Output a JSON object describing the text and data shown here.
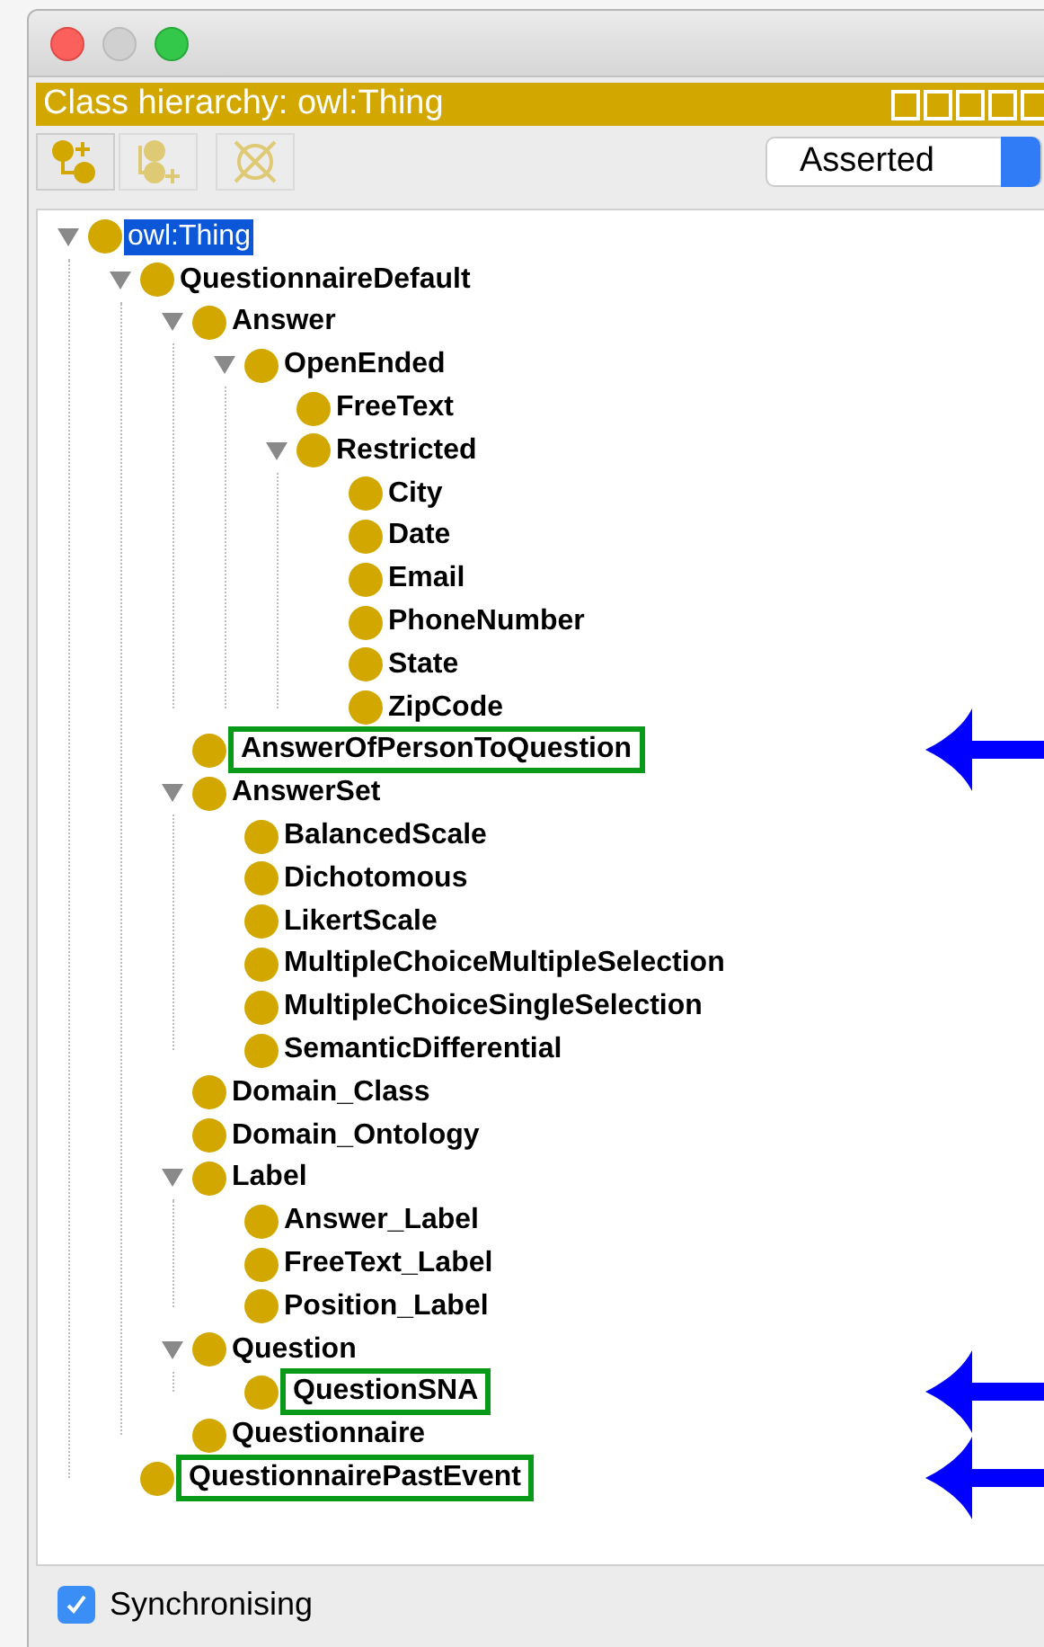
{
  "window": {
    "title": "Class hierarchy: owl:Thing"
  },
  "toolbar": {
    "view_select": {
      "value": "Asserted"
    }
  },
  "tree": [
    {
      "label": "owl:Thing",
      "selected": true,
      "boxed": false,
      "expanded": true,
      "children": [
        {
          "label": "QuestionnaireDefault",
          "selected": false,
          "boxed": false,
          "expanded": true,
          "children": [
            {
              "label": "Answer",
              "selected": false,
              "boxed": false,
              "expanded": true,
              "children": [
                {
                  "label": "OpenEnded",
                  "selected": false,
                  "boxed": false,
                  "expanded": true,
                  "children": [
                    {
                      "label": "FreeText",
                      "selected": false,
                      "boxed": false
                    },
                    {
                      "label": "Restricted",
                      "selected": false,
                      "boxed": false,
                      "expanded": true,
                      "children": [
                        {
                          "label": "City",
                          "selected": false,
                          "boxed": false
                        },
                        {
                          "label": "Date",
                          "selected": false,
                          "boxed": false
                        },
                        {
                          "label": "Email",
                          "selected": false,
                          "boxed": false
                        },
                        {
                          "label": "PhoneNumber",
                          "selected": false,
                          "boxed": false
                        },
                        {
                          "label": "State",
                          "selected": false,
                          "boxed": false
                        },
                        {
                          "label": "ZipCode",
                          "selected": false,
                          "boxed": false
                        }
                      ]
                    }
                  ]
                }
              ]
            },
            {
              "label": "AnswerOfPersonToQuestion",
              "selected": false,
              "boxed": true
            },
            {
              "label": "AnswerSet",
              "selected": false,
              "boxed": false,
              "expanded": true,
              "children": [
                {
                  "label": "BalancedScale",
                  "selected": false,
                  "boxed": false
                },
                {
                  "label": "Dichotomous",
                  "selected": false,
                  "boxed": false
                },
                {
                  "label": "LikertScale",
                  "selected": false,
                  "boxed": false
                },
                {
                  "label": "MultipleChoiceMultipleSelection",
                  "selected": false,
                  "boxed": false
                },
                {
                  "label": "MultipleChoiceSingleSelection",
                  "selected": false,
                  "boxed": false
                },
                {
                  "label": "SemanticDifferential",
                  "selected": false,
                  "boxed": false
                }
              ]
            },
            {
              "label": "Domain_Class",
              "selected": false,
              "boxed": false
            },
            {
              "label": "Domain_Ontology",
              "selected": false,
              "boxed": false
            },
            {
              "label": "Label",
              "selected": false,
              "boxed": false,
              "expanded": true,
              "children": [
                {
                  "label": "Answer_Label",
                  "selected": false,
                  "boxed": false
                },
                {
                  "label": "FreeText_Label",
                  "selected": false,
                  "boxed": false
                },
                {
                  "label": "Position_Label",
                  "selected": false,
                  "boxed": false
                }
              ]
            },
            {
              "label": "Question",
              "selected": false,
              "boxed": false,
              "expanded": true,
              "children": [
                {
                  "label": "QuestionSNA",
                  "selected": false,
                  "boxed": true
                }
              ]
            },
            {
              "label": "Questionnaire",
              "selected": false,
              "boxed": false
            }
          ]
        },
        {
          "label": "QuestionnairePastEvent",
          "selected": false,
          "boxed": true
        }
      ]
    }
  ],
  "footer": {
    "checkbox": {
      "label": "Synchronising",
      "checked": true
    }
  }
}
